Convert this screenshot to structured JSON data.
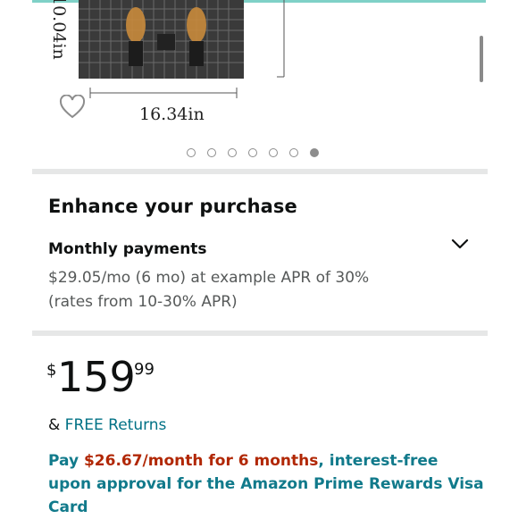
{
  "product": {
    "dim_height": "10.04in",
    "dim_width": "16.34in"
  },
  "carousel": {
    "total": 7,
    "active": 6
  },
  "enhance": {
    "title": "Enhance your purchase",
    "monthly_title": "Monthly payments",
    "monthly_line1": "$29.05/mo (6 mo) at example APR of 30%",
    "monthly_line2": "(rates from 10-30% APR)"
  },
  "price": {
    "symbol": "$",
    "whole": "159",
    "fraction": "99"
  },
  "returns": {
    "prefix": "& ",
    "link": "FREE Returns"
  },
  "promo": {
    "pay": "Pay ",
    "amount": "$26.67/month for 6 months",
    "rest": ", interest-free upon approval for the Amazon Prime Rewards Visa Card"
  },
  "colors": {
    "link": "#007185",
    "promo": "#117a8b",
    "price_red": "#b12704",
    "divider": "#e6e7e7"
  }
}
